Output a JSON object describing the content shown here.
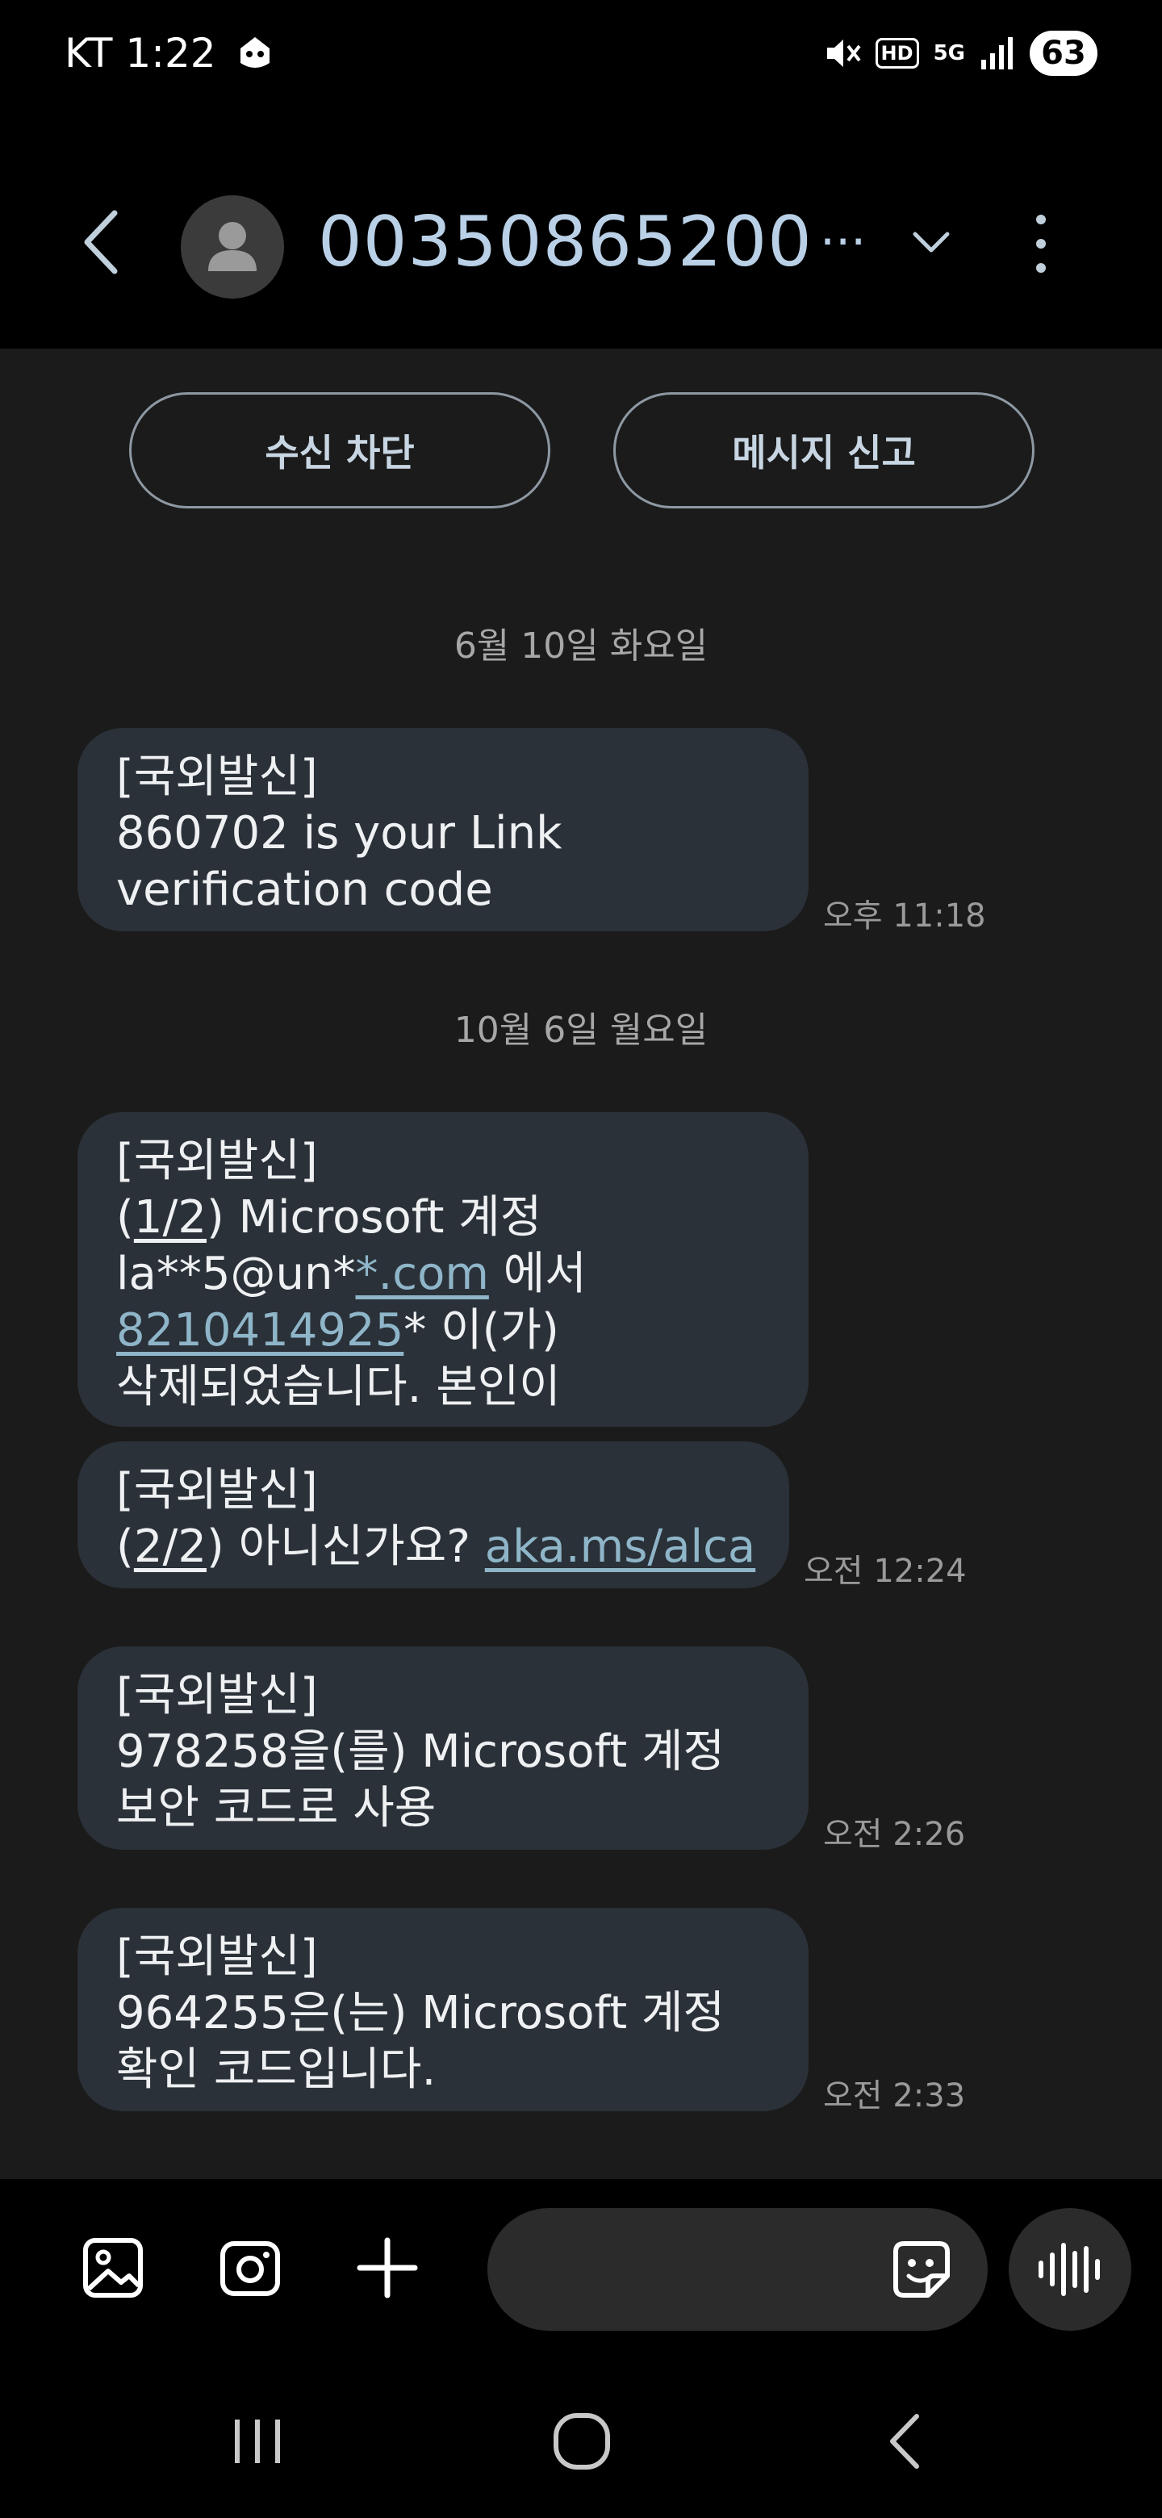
{
  "status_bar": {
    "carrier_time": "KT 1:22",
    "hd_label": "HD",
    "network": "5G",
    "battery": "63"
  },
  "header": {
    "contact": "00350865200",
    "ellipsis": "···"
  },
  "actions": {
    "block_label": "수신 차단",
    "report_label": "메시지 신고"
  },
  "thread": {
    "date_1": "6월 10일 화요일",
    "date_2": "10월 6일 월요일",
    "messages": [
      {
        "tag": "[국외발신]",
        "line1": "860702 is your Link",
        "line2": "verification code",
        "time": "오후 11:18"
      },
      {
        "tag": "[국외발신]",
        "line1_pre": "(",
        "line1_link": "1/2",
        "line1_post": ") Microsoft 계정",
        "line2_pre": "la**5@un*",
        "line2_link": "*.com",
        "line2_post": " 에서",
        "line3_link": "8210414925",
        "line3_post": "* 이(가)",
        "line4": "삭제되었습니다. 본인이"
      },
      {
        "tag": "[국외발신]",
        "line1_pre": "(",
        "line1_link": "2/2",
        "line1_post": ") 아니신가요? ",
        "line1_url": "aka.ms/alca",
        "time": "오전 12:24"
      },
      {
        "tag": "[국외발신]",
        "line1": "978258을(를) Microsoft 계정",
        "line2": "보안 코드로 사용",
        "time": "오전 2:26"
      },
      {
        "tag": "[국외발신]",
        "line1": "964255은(는) Microsoft 계정",
        "line2": "확인 코드입니다.",
        "time": "오전 2:33"
      }
    ]
  },
  "icons": {
    "back": "chevron-left-icon",
    "avatar": "person-icon",
    "expand": "chevron-down-icon",
    "more": "more-vertical-icon",
    "gallery": "gallery-icon",
    "camera": "camera-icon",
    "add": "plus-icon",
    "sticker": "sticker-icon",
    "voice": "voice-wave-icon"
  },
  "colors": {
    "background": "#1b1b1b",
    "bubble": "#2a3138",
    "link": "#8fb5c9",
    "title": "#b9d0e6"
  }
}
